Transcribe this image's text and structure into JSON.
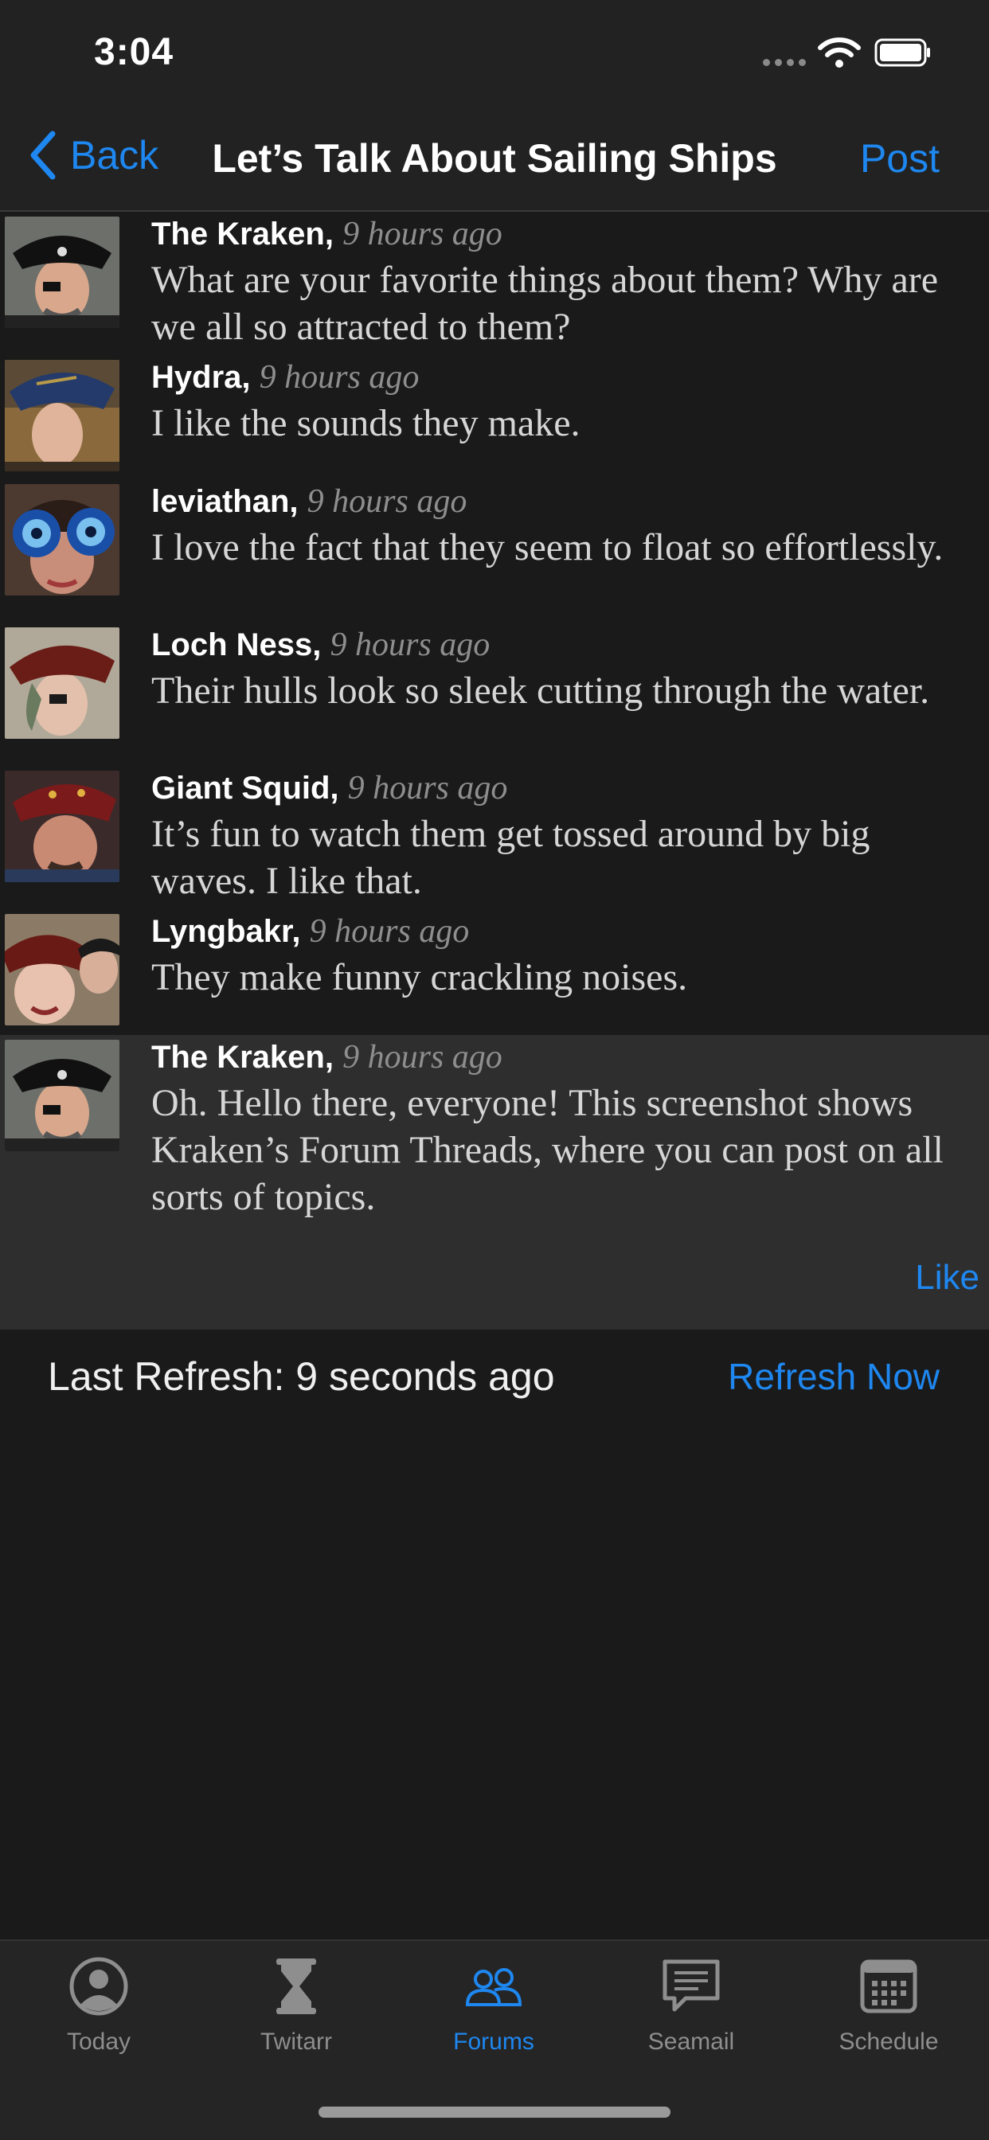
{
  "status_bar": {
    "time": "3:04"
  },
  "nav": {
    "back_label": "Back",
    "title": "Let’s Talk About Sailing Ships",
    "post_label": "Post"
  },
  "posts": [
    {
      "author": "The Kraken,",
      "time": "9 hours ago",
      "text": "What are your favorite things about them? Why are we all so attracted to them?"
    },
    {
      "author": "Hydra,",
      "time": "9 hours ago",
      "text": "I like the sounds they make."
    },
    {
      "author": "leviathan,",
      "time": "9 hours ago",
      "text": "I love the fact that they seem to float so effortlessly."
    },
    {
      "author": "Loch Ness,",
      "time": "9 hours ago",
      "text": "Their hulls look so sleek cutting through the water."
    },
    {
      "author": "Giant Squid,",
      "time": "9 hours ago",
      "text": "It’s fun to watch them get tossed around by big waves. I like that."
    },
    {
      "author": "Lyngbakr,",
      "time": "9 hours ago",
      "text": "They make funny crackling noises."
    },
    {
      "author": "The Kraken,",
      "time": "9 hours ago",
      "text": "Oh. Hello there, everyone! This screenshot shows Kraken’s Forum Threads, where you can post on all sorts of topics.",
      "like_label": "Like"
    }
  ],
  "refresh": {
    "label": "Last Refresh: 9 seconds ago",
    "button": "Refresh Now"
  },
  "tabs": [
    {
      "label": "Today",
      "icon": "person-circle-icon"
    },
    {
      "label": "Twitarr",
      "icon": "hourglass-icon"
    },
    {
      "label": "Forums",
      "icon": "people-icon",
      "active": true
    },
    {
      "label": "Seamail",
      "icon": "chat-bubble-icon"
    },
    {
      "label": "Schedule",
      "icon": "calendar-icon"
    }
  ],
  "colors": {
    "accent": "#1e87f0",
    "background": "#1a1a1a",
    "highlight_row": "#2e2e2e",
    "timestamp": "#8e8e8e"
  }
}
